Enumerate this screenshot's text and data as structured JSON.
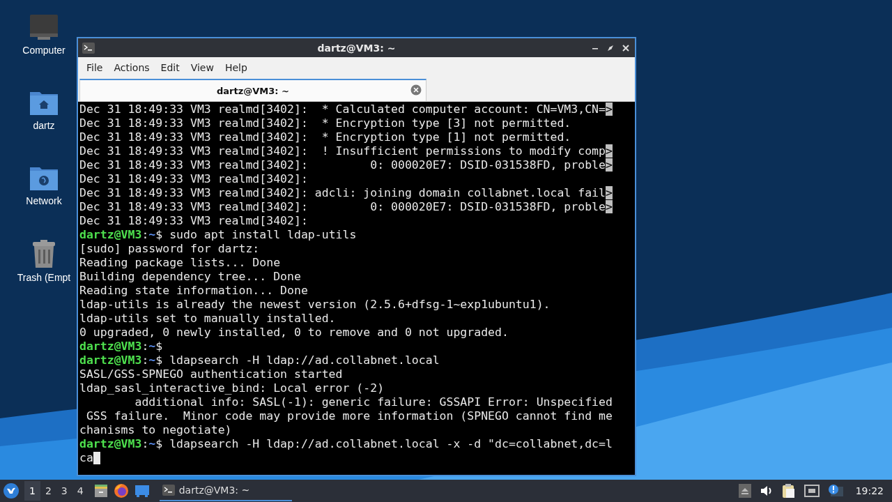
{
  "desktop": {
    "icons": [
      {
        "kind": "computer",
        "label": "Computer"
      },
      {
        "kind": "home",
        "label": "dartz"
      },
      {
        "kind": "network",
        "label": "Network"
      },
      {
        "kind": "trash",
        "label": "Trash (Empt"
      }
    ]
  },
  "window": {
    "title": "dartz@VM3: ~",
    "menu": [
      "File",
      "Actions",
      "Edit",
      "View",
      "Help"
    ],
    "tabs": [
      {
        "label": "dartz@VM3: ~",
        "selected": true
      }
    ],
    "lines": [
      {
        "kind": "text",
        "text": "Dec 31 18:49:33 VM3 realmd[3402]:  * Calculated computer account: CN=VM3,CN=",
        "marker": ">"
      },
      {
        "kind": "text",
        "text": "Dec 31 18:49:33 VM3 realmd[3402]:  * Encryption type [3] not permitted."
      },
      {
        "kind": "text",
        "text": "Dec 31 18:49:33 VM3 realmd[3402]:  * Encryption type [1] not permitted."
      },
      {
        "kind": "text",
        "text": "Dec 31 18:49:33 VM3 realmd[3402]:  ! Insufficient permissions to modify comp",
        "marker": ">"
      },
      {
        "kind": "text",
        "text": "Dec 31 18:49:33 VM3 realmd[3402]:         0: 000020E7: DSID-031538FD, proble",
        "marker": ">"
      },
      {
        "kind": "text",
        "text": "Dec 31 18:49:33 VM3 realmd[3402]:"
      },
      {
        "kind": "text",
        "text": "Dec 31 18:49:33 VM3 realmd[3402]: adcli: joining domain collabnet.local fail",
        "marker": ">"
      },
      {
        "kind": "text",
        "text": "Dec 31 18:49:33 VM3 realmd[3402]:         0: 000020E7: DSID-031538FD, proble",
        "marker": ">"
      },
      {
        "kind": "text",
        "text": "Dec 31 18:49:33 VM3 realmd[3402]:"
      },
      {
        "kind": "prompt",
        "user": "dartz@VM3",
        "sep": ":",
        "path": "~",
        "text": "$ sudo apt install ldap-utils"
      },
      {
        "kind": "text",
        "text": "[sudo] password for dartz:"
      },
      {
        "kind": "text",
        "text": "Reading package lists... Done"
      },
      {
        "kind": "text",
        "text": "Building dependency tree... Done"
      },
      {
        "kind": "text",
        "text": "Reading state information... Done"
      },
      {
        "kind": "text",
        "text": "ldap-utils is already the newest version (2.5.6+dfsg-1~exp1ubuntu1)."
      },
      {
        "kind": "text",
        "text": "ldap-utils set to manually installed."
      },
      {
        "kind": "text",
        "text": "0 upgraded, 0 newly installed, 0 to remove and 0 not upgraded."
      },
      {
        "kind": "prompt",
        "user": "dartz@VM3",
        "sep": ":",
        "path": "~",
        "text": "$"
      },
      {
        "kind": "prompt",
        "user": "dartz@VM3",
        "sep": ":",
        "path": "~",
        "text": "$ ldapsearch -H ldap://ad.collabnet.local"
      },
      {
        "kind": "text",
        "text": "SASL/GSS-SPNEGO authentication started"
      },
      {
        "kind": "text",
        "text": "ldap_sasl_interactive_bind: Local error (-2)"
      },
      {
        "kind": "text",
        "text": "        additional info: SASL(-1): generic failure: GSSAPI Error: Unspecified"
      },
      {
        "kind": "text",
        "text": " GSS failure.  Minor code may provide more information (SPNEGO cannot find me"
      },
      {
        "kind": "text",
        "text": "chanisms to negotiate)"
      },
      {
        "kind": "prompt",
        "user": "dartz@VM3",
        "sep": ":",
        "path": "~",
        "text": "$ ldapsearch -H ldap://ad.collabnet.local -x -d \"dc=collabnet,dc=l"
      },
      {
        "kind": "text",
        "text": "ca",
        "cursor": true
      }
    ]
  },
  "taskbar": {
    "workspaces": [
      {
        "label": "1",
        "selected": true
      },
      {
        "label": "2",
        "selected": false
      },
      {
        "label": "3",
        "selected": false
      },
      {
        "label": "4",
        "selected": false
      }
    ],
    "launchers": [
      {
        "kind": "files"
      },
      {
        "kind": "browser"
      },
      {
        "kind": "desktop"
      }
    ],
    "tasks": [
      {
        "label": "dartz@VM3: ~",
        "selected": true
      }
    ],
    "tray": [
      {
        "kind": "eject"
      },
      {
        "kind": "volume"
      },
      {
        "kind": "clipboard"
      },
      {
        "kind": "network"
      },
      {
        "kind": "notification"
      }
    ],
    "clock": "19:22"
  }
}
